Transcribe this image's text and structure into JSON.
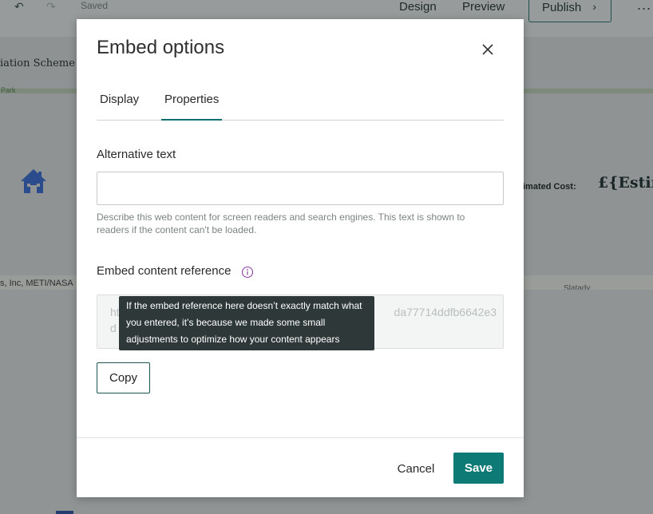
{
  "app": {
    "toolbar": {
      "undo_icon": "undo-icon",
      "redo_icon": "redo-icon",
      "saved_label": "Saved",
      "design_label": "Design",
      "preview_label": "Preview",
      "publish_label": "Publish",
      "more_label": "..."
    },
    "story_title_fragment": "iation Scheme",
    "map_label": "Park",
    "estimate_label": "imated Cost:",
    "estimate_value": "£{Estim",
    "attribution": "s, Inc, METI/NASA",
    "place_label": "Slatady"
  },
  "modal": {
    "title": "Embed options",
    "tabs": [
      {
        "label": "Display",
        "active": false
      },
      {
        "label": "Properties",
        "active": true
      }
    ],
    "alt_text": {
      "label": "Alternative text",
      "value": "",
      "placeholder": "",
      "help": "Describe this web content for screen readers and search engines. This text is shown to readers if the content can't be loaded."
    },
    "embed_reference": {
      "label": "Embed content reference",
      "value_start": "ht",
      "value_end": "da77714ddfb6642e3",
      "value_line2": "d",
      "tooltip": "If the embed reference here doesn’t exactly match what you entered, it’s because we made some small adjustments to optimize how your content appears"
    },
    "copy_label": "Copy",
    "cancel_label": "Cancel",
    "save_label": "Save"
  },
  "colors": {
    "accent": "#0e7a76",
    "tab_underline": "#0f6e6e",
    "tooltip_bg": "#2f3838",
    "info_icon": "#8a3fa0",
    "house_icon": "#2b4c8c"
  }
}
